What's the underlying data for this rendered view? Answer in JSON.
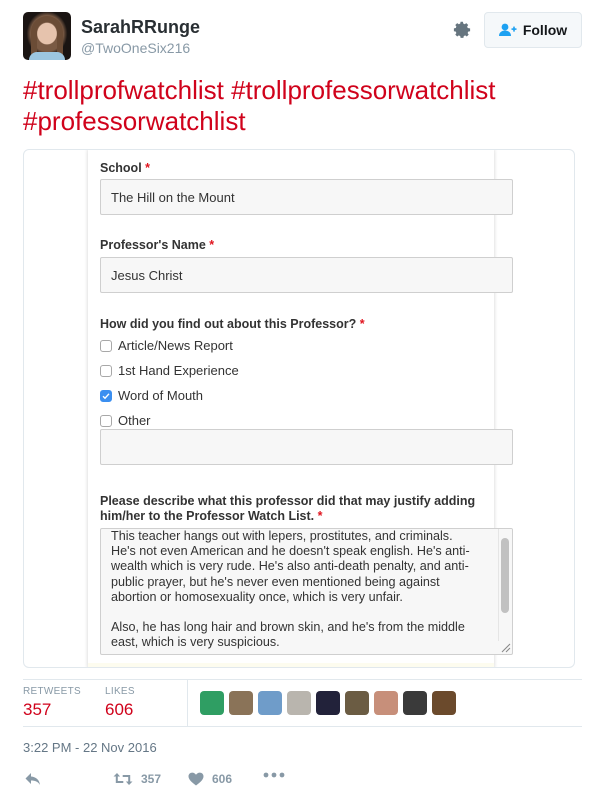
{
  "user": {
    "display_name": "SarahRRunge",
    "handle": "@TwoOneSix216",
    "avatar_icon": "profile-photo"
  },
  "header": {
    "settings_icon": "gear-icon",
    "follow_label": "Follow",
    "follow_icon": "person-plus-icon"
  },
  "tweet": {
    "hashtags": [
      "#trollprofwatchlist",
      "#trollprofessorwatchlist",
      "#professorwatchlist"
    ],
    "accent_color": "#d0021b"
  },
  "form": {
    "school": {
      "label": "School",
      "required_mark": "*",
      "value": "The Hill on the Mount"
    },
    "professor_name": {
      "label": "Professor's Name",
      "required_mark": "*",
      "value": "Jesus Christ"
    },
    "source": {
      "label": "How did you find out about this Professor?",
      "required_mark": "*",
      "options": [
        {
          "label": "Article/News Report",
          "checked": false
        },
        {
          "label": "1st Hand Experience",
          "checked": false
        },
        {
          "label": "Word of Mouth",
          "checked": true
        },
        {
          "label": "Other",
          "checked": false
        }
      ],
      "other_value": ""
    },
    "description": {
      "label_line1": "Please describe what this professor did that may justify adding",
      "label_line2": "him/her to the Professor Watch List.",
      "required_mark": "*",
      "value": "This teacher hangs out with lepers, prostitutes, and criminals.\nHe's not even American and he doesn't speak english. He's anti-\nwealth which is very rude. He's also anti-death penalty, and anti-\npublic prayer, but he's never even mentioned being against\nabortion or homosexuality once, which is very unfair.\n\nAlso, he has long hair and brown skin, and he's from the middle\neast, which is very suspicious."
    }
  },
  "stats": {
    "retweets_label": "RETWEETS",
    "retweets_value": "357",
    "likes_label": "LIKES",
    "likes_value": "606",
    "liker_avatars": [
      {
        "name": "liker-1",
        "color": "#2f9e63"
      },
      {
        "name": "liker-2",
        "color": "#8a7358"
      },
      {
        "name": "liker-3",
        "color": "#6f9cc9"
      },
      {
        "name": "liker-4",
        "color": "#b9b5ae"
      },
      {
        "name": "liker-5",
        "color": "#22223a"
      },
      {
        "name": "liker-6",
        "color": "#6b5c43"
      },
      {
        "name": "liker-7",
        "color": "#c78f7a"
      },
      {
        "name": "liker-8",
        "color": "#3a3a3a"
      },
      {
        "name": "liker-9",
        "color": "#6b4a2c"
      }
    ]
  },
  "timestamp": "3:22 PM - 22 Nov 2016",
  "actions": {
    "reply_icon": "reply-icon",
    "retweet_icon": "retweet-icon",
    "retweet_count": "357",
    "like_icon": "heart-icon",
    "like_count": "606",
    "more_icon": "more-icon"
  }
}
